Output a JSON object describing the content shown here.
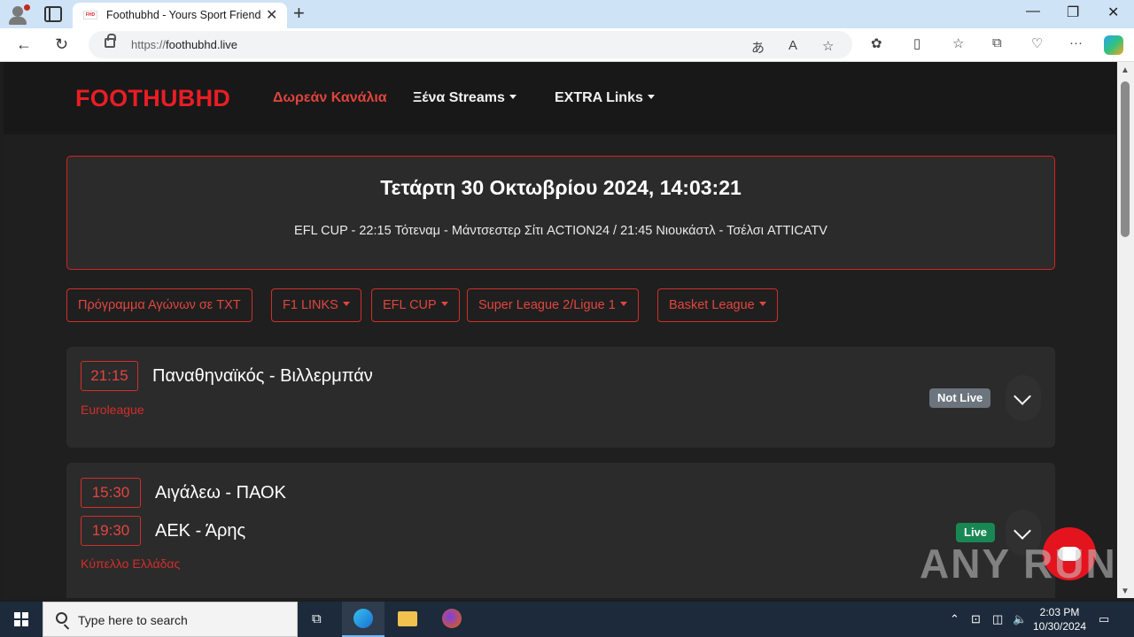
{
  "browser": {
    "tab_title": "Foothubhd - Yours Sport Friend",
    "favicon_text": "FHD",
    "url_prefix": "https://",
    "url_host": "foothubhd.live"
  },
  "site": {
    "brand": "FOOTHUBHD",
    "nav": [
      {
        "label": "Δωρεάν Κανάλια",
        "active": true
      },
      {
        "label": "Ξένα Streams"
      },
      {
        "label": "EXTRA Links"
      }
    ]
  },
  "hero": {
    "datetime": "Τετάρτη 30 Οκτωβρίου 2024, 14:03:21",
    "ticker": "EFL CUP - 22:15 Τότεναμ - Μάντσεστερ Σίτι ACTION24 / 21:45 Νιουκάστλ - Τσέλσι ATTICATV"
  },
  "filters": [
    "Πρόγραμμα Αγώνων σε TXT",
    "F1 LINKS",
    "EFL CUP",
    "Super League 2/Ligue 1",
    "Basket League"
  ],
  "matches": [
    {
      "games": [
        {
          "time": "21:15",
          "name": "Παναθηναϊκός - Βιλλερμπάν"
        }
      ],
      "league": "Euroleague",
      "status": "Not Live"
    },
    {
      "games": [
        {
          "time": "15:30",
          "name": "Αιγάλεω - ΠΑΟΚ"
        },
        {
          "time": "19:30",
          "name": "ΑΕΚ - Άρης"
        }
      ],
      "league": "Κύπελλο Ελλάδας",
      "status": "Live"
    }
  ],
  "watermark": "ANY RUN",
  "taskbar": {
    "search_placeholder": "Type here to search",
    "time": "2:03 PM",
    "date": "10/30/2024"
  },
  "colors": {
    "accent_red": "#ea1d25",
    "live_green": "#198754",
    "notlive_gray": "#6c757d"
  }
}
